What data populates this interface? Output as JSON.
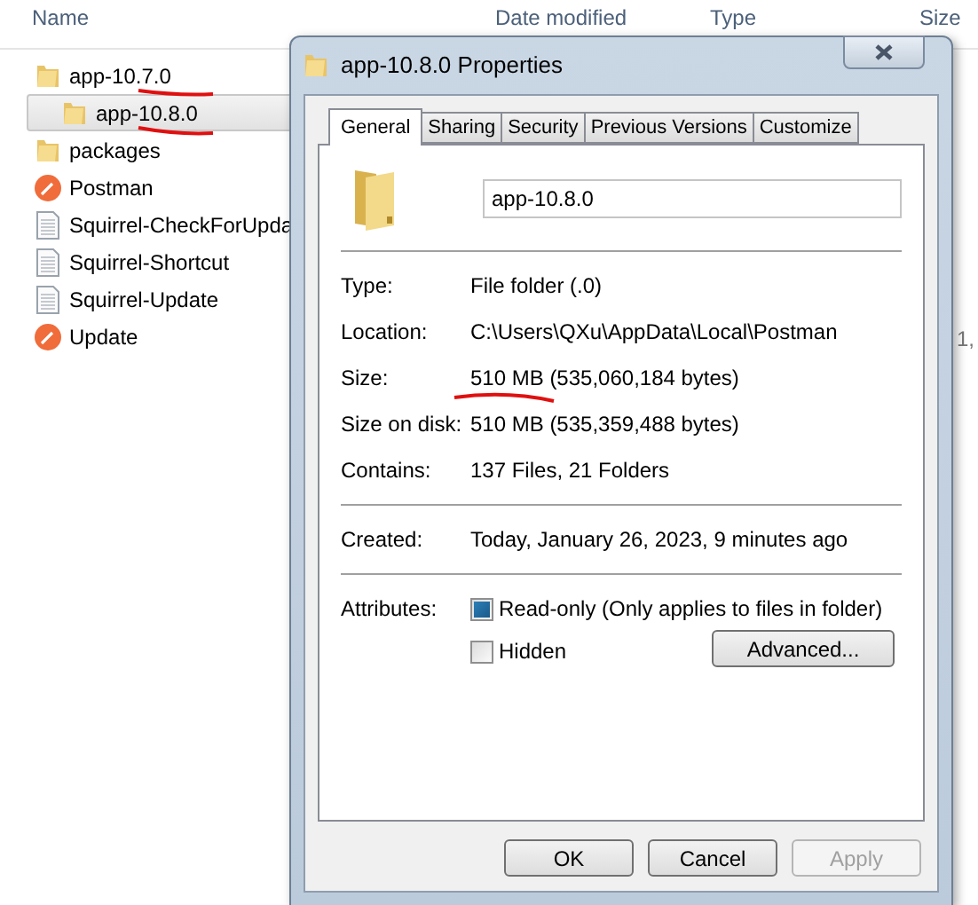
{
  "explorer": {
    "columns": [
      "Name",
      "Date modified",
      "Type",
      "Size"
    ],
    "rows": [
      {
        "name": "app-10.7.0",
        "kind": "folder",
        "selected": false
      },
      {
        "name": "app-10.8.0",
        "kind": "folder",
        "selected": true
      },
      {
        "name": "packages",
        "kind": "folder",
        "selected": false
      },
      {
        "name": "Postman",
        "kind": "app",
        "selected": false
      },
      {
        "name": "Squirrel-CheckForUpda",
        "kind": "file",
        "selected": false
      },
      {
        "name": "Squirrel-Shortcut",
        "kind": "file",
        "selected": false
      },
      {
        "name": "Squirrel-Update",
        "kind": "file",
        "selected": false
      },
      {
        "name": "Update",
        "kind": "app",
        "selected": false,
        "size": "1,"
      }
    ]
  },
  "dialog": {
    "title": "app-10.8.0 Properties",
    "tabs": [
      {
        "label": "General",
        "selected": true
      },
      {
        "label": "Sharing",
        "selected": false
      },
      {
        "label": "Security",
        "selected": false
      },
      {
        "label": "Previous Versions",
        "selected": false
      },
      {
        "label": "Customize",
        "selected": false
      }
    ],
    "name_field": {
      "value": "app-10.8.0"
    },
    "groups": [
      [
        {
          "label": "Type:",
          "value": "File folder (.0)"
        },
        {
          "label": "Location:",
          "value": "C:\\Users\\QXu\\AppData\\Local\\Postman"
        },
        {
          "label": "Size:",
          "value": "510 MB (535,060,184 bytes)"
        },
        {
          "label": "Size on disk:",
          "value": "510 MB (535,359,488 bytes)"
        },
        {
          "label": "Contains:",
          "value": "137 Files, 21 Folders"
        }
      ],
      [
        {
          "label": "Created:",
          "value": "Today, January 26, 2023, 9 minutes ago"
        }
      ]
    ],
    "attributes": {
      "label": "Attributes:",
      "options": [
        {
          "label": "Read-only (Only applies to files in folder)",
          "checked": true
        },
        {
          "label": "Hidden",
          "checked": false
        }
      ],
      "advanced_button": "Advanced..."
    },
    "buttons": [
      {
        "label": "OK",
        "disabled": false
      },
      {
        "label": "Cancel",
        "disabled": false
      },
      {
        "label": "Apply",
        "disabled": true
      }
    ]
  }
}
